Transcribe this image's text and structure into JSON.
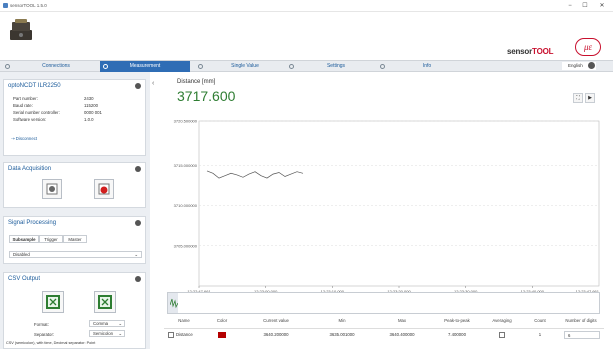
{
  "window": {
    "title": "sensorTOOL 1.5.0",
    "min": "−",
    "max": "☐",
    "close": "✕"
  },
  "brand": {
    "sensor": "sensor",
    "tool": "TOOL",
    "mark": "με"
  },
  "nav": {
    "tabs": [
      {
        "label": "Connections"
      },
      {
        "label": "Measurement"
      },
      {
        "label": "Single Value"
      },
      {
        "label": "Settings"
      },
      {
        "label": "Info"
      }
    ],
    "language": "English"
  },
  "sensor_card": {
    "title": "optoNCDT ILR2250",
    "rows": [
      {
        "k": "Part number:",
        "v": "2430"
      },
      {
        "k": "Baud rate:",
        "v": "115200"
      },
      {
        "k": "Serial number controller:",
        "v": "0000 001"
      },
      {
        "k": "Software version:",
        "v": "1.0.0"
      }
    ],
    "disconnect": "Disconnect"
  },
  "acquisition": {
    "title": "Data Acquisition"
  },
  "signal": {
    "title": "Signal Processing",
    "tabs": [
      "Subsample",
      "Trigger",
      "Master"
    ],
    "select": "Disabled"
  },
  "csv": {
    "title": "CSV Output",
    "format_label": "Format:",
    "format_value": "Comma",
    "separator_label": "Separator:",
    "separator_value": "Semicolon",
    "footer": "CSV (semicolon), with time, Decimal separator: Point"
  },
  "chart_head": {
    "title": "Distance [mm]",
    "value": "3717.600"
  },
  "chart_data": {
    "type": "line",
    "ylim": [
      3700.0,
      3720.5
    ],
    "yticks": [
      "3720.500000",
      "3715.000000",
      "3710.000000",
      "3705.000000"
    ],
    "xticks": [
      "12:22:47.661",
      "12:23:00.000",
      "12:23:10.000",
      "12:23:20.000",
      "12:23:30.000",
      "12:23:40.000"
    ],
    "x_last": "12:23:47.661",
    "series": [
      {
        "color": "#555555",
        "values": [
          3714.3,
          3714.0,
          3713.4,
          3713.7,
          3714.0,
          3713.8,
          3713.5,
          3713.9,
          3714.2,
          3713.7,
          3713.4,
          3713.9,
          3714.1,
          3713.6,
          3713.9,
          3714.2,
          3714.0
        ]
      }
    ]
  },
  "table": {
    "headers": [
      "Name",
      "Color",
      "Current value",
      "Min",
      "Max",
      "Peak-to-peak",
      "Averaging",
      "Count",
      "Number of digits"
    ],
    "row": {
      "name": "Distance",
      "color": "#b40000",
      "current": "3640.200000",
      "min": "3635.001000",
      "max": "3640.400000",
      "p2p": "7.400000",
      "count": "1",
      "digits": "6"
    }
  }
}
